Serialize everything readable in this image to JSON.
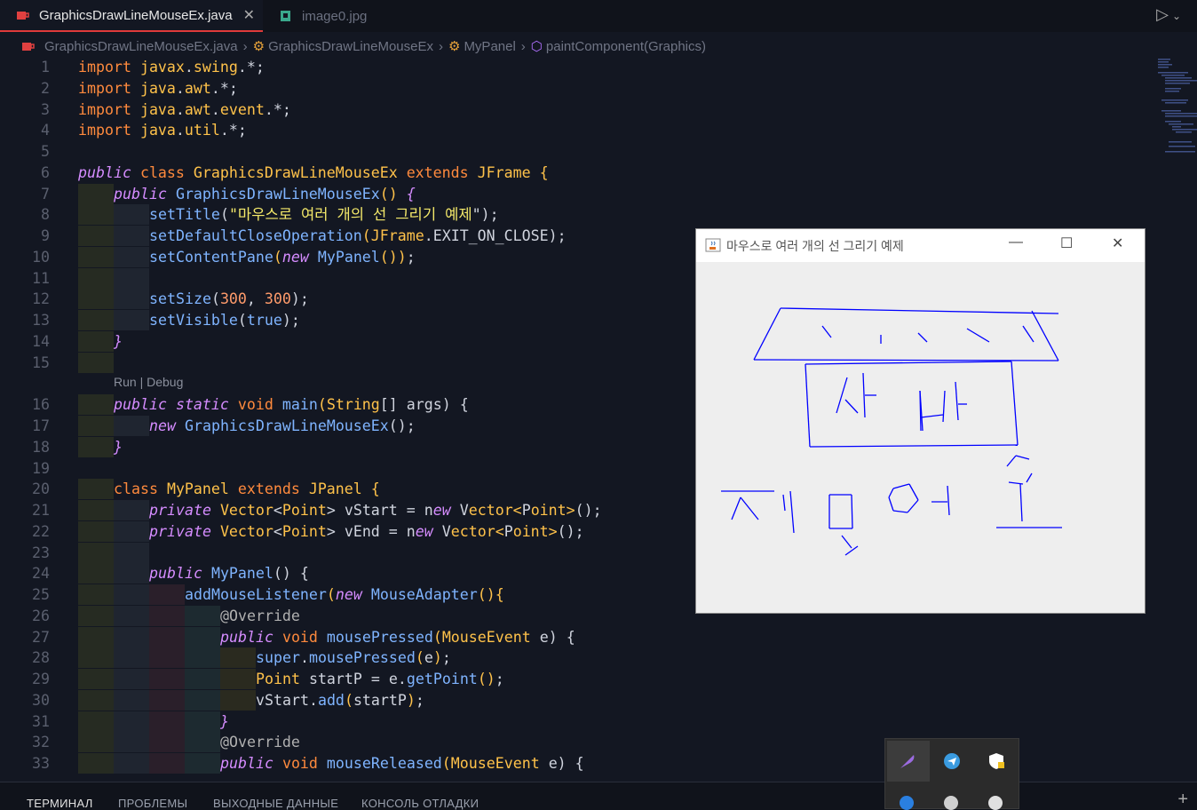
{
  "tabs": [
    {
      "label": "GraphicsDrawLineMouseEx.java",
      "close": "✕"
    },
    {
      "label": "image0.jpg"
    }
  ],
  "breadcrumb": {
    "file": "GraphicsDrawLineMouseEx.java",
    "class": "GraphicsDrawLineMouseEx",
    "inner": "MyPanel",
    "method": "paintComponent(Graphics)"
  },
  "codelens": "Run | Debug",
  "code": {
    "l1": [
      "1",
      "import javax.swing.*;"
    ],
    "l2": [
      "2",
      "import java.awt.*;"
    ],
    "l3": [
      "3",
      "import java.awt.event.*;"
    ],
    "l4": [
      "4",
      "import java.util.*;"
    ],
    "l5": [
      "5",
      ""
    ],
    "l6": [
      "6",
      "public class GraphicsDrawLineMouseEx extends JFrame {"
    ],
    "l7": [
      "7",
      "public GraphicsDrawLineMouseEx() {"
    ],
    "l8": [
      "8",
      "setTitle(\"마우스로 여러 개의 선 그리기 예제\");"
    ],
    "l9": [
      "9",
      "setDefaultCloseOperation(JFrame.EXIT_ON_CLOSE);"
    ],
    "l10": [
      "10",
      "setContentPane(new MyPanel());"
    ],
    "l11": [
      "11",
      ""
    ],
    "l12": [
      "12",
      "setSize(300, 300);"
    ],
    "l13": [
      "13",
      "setVisible(true);"
    ],
    "l14": [
      "14",
      "}"
    ],
    "l15": [
      "15",
      ""
    ],
    "l16": [
      "16",
      "public static void main(String[] args) {"
    ],
    "l17": [
      "17",
      "new GraphicsDrawLineMouseEx();"
    ],
    "l18": [
      "18",
      "}"
    ],
    "l19": [
      "19",
      ""
    ],
    "l20": [
      "20",
      "class MyPanel extends JPanel {"
    ],
    "l21": [
      "21",
      "private Vector<Point> vStart = new Vector<Point>();"
    ],
    "l22": [
      "22",
      "private Vector<Point> vEnd = new Vector<Point>();"
    ],
    "l23": [
      "23",
      ""
    ],
    "l24": [
      "24",
      "public MyPanel() {"
    ],
    "l25": [
      "25",
      "addMouseListener(new MouseAdapter(){"
    ],
    "l26": [
      "26",
      "@Override"
    ],
    "l27": [
      "27",
      "public void mousePressed(MouseEvent e) {"
    ],
    "l28": [
      "28",
      "super.mousePressed(e);"
    ],
    "l29": [
      "29",
      "Point startP = e.getPoint();"
    ],
    "l30": [
      "30",
      "vStart.add(startP);"
    ],
    "l31": [
      "31",
      "}"
    ],
    "l32": [
      "32",
      "@Override"
    ],
    "l33": [
      "33",
      "public void mouseReleased(MouseEvent e) {"
    ]
  },
  "panel_tabs": [
    "ТЕРМИНАЛ",
    "ПРОБЛЕМЫ",
    "ВЫХОДНЫЕ ДАННЫЕ",
    "КОНСОЛЬ ОТЛАДКИ"
  ],
  "java_window": {
    "title": "마우스로 여러 개의 선 그리기 예제",
    "line_color": "#0000ff"
  },
  "colors": {
    "editor_bg": "#131722",
    "accent_tab": "#e03a3a"
  }
}
